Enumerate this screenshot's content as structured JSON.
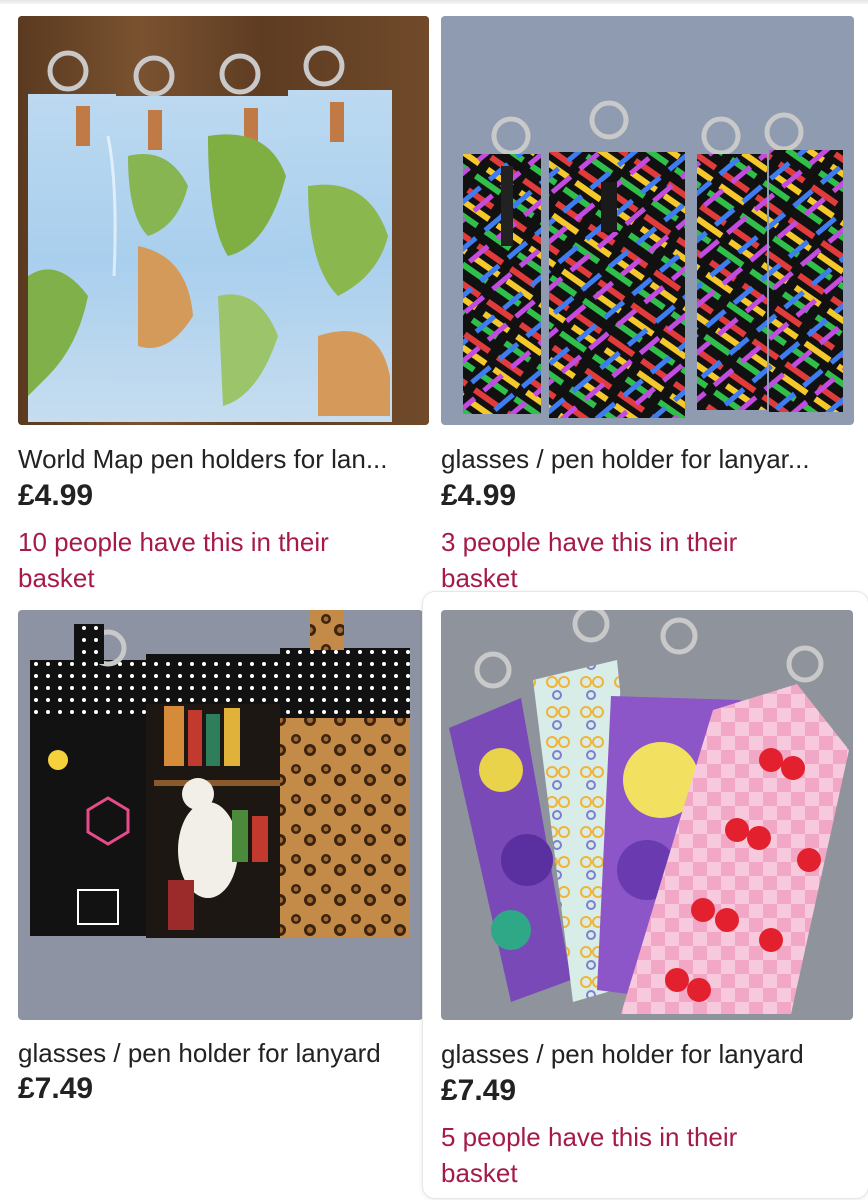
{
  "listings": [
    {
      "title": "World Map pen holders for lan...",
      "price": "£4.99",
      "basket_line1": "10 people have this in their",
      "basket_line2": "basket"
    },
    {
      "title": "glasses / pen holder for lanyar...",
      "price": "£4.99",
      "basket_line1": "3 people have this in their",
      "basket_line2": "basket"
    },
    {
      "title": "glasses / pen holder for lanyard",
      "price": "£7.49"
    },
    {
      "title": "glasses / pen holder for lanyard",
      "price": "£7.49",
      "basket_line1": "5 people have this in their",
      "basket_line2": "basket"
    }
  ],
  "colors": {
    "text": "#222222",
    "basket_text": "#a61a4a",
    "background": "#ffffff"
  }
}
